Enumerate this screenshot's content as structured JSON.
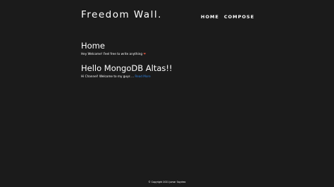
{
  "header": {
    "brand": "Freedom Wall.",
    "nav": [
      {
        "label": "HOME"
      },
      {
        "label": "COMPOSE"
      }
    ]
  },
  "home": {
    "title": "Home",
    "intro": "Hey Welcome! Feel free to write anything",
    "intro_emoji": "❤"
  },
  "posts": [
    {
      "title": "Hello MongoDB Altas!!",
      "excerpt": "Hi Channel! Welcome to my guys ...",
      "read_more": "Read More"
    }
  ],
  "footer": {
    "copyright": "© Copyright 2021 Jomar Saydrez"
  }
}
